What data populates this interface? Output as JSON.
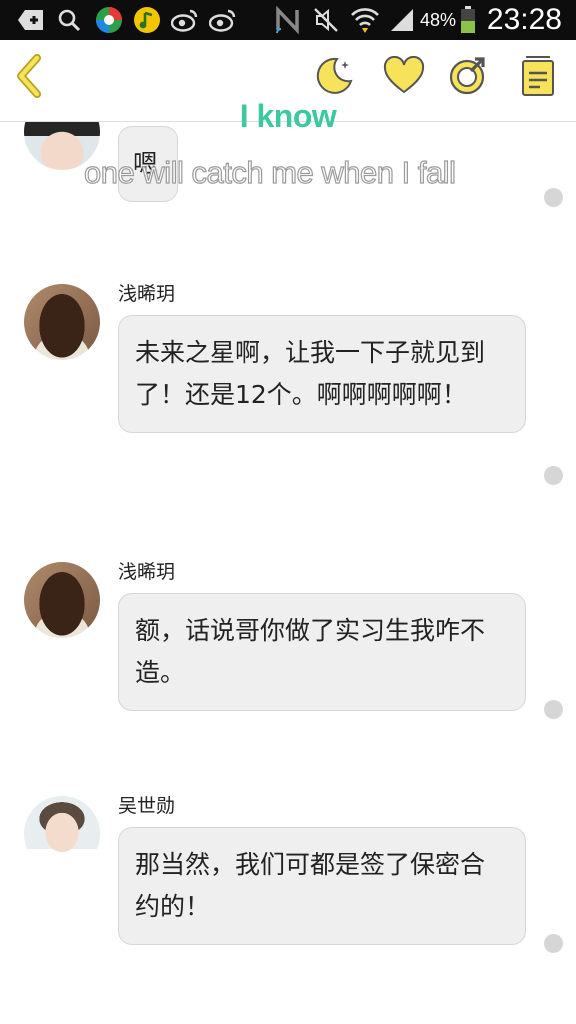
{
  "status_bar": {
    "battery_percent": "48%",
    "time": "23:28",
    "icons": [
      "add-icon",
      "search-icon",
      "app-icon",
      "music-icon",
      "weibo-icon",
      "weibo-icon",
      "nfc-icon",
      "mute-icon",
      "wifi-icon",
      "signal-icon",
      "battery-icon"
    ]
  },
  "header": {
    "icons": [
      "back-icon",
      "night-mode-icon",
      "favorite-icon",
      "share-icon",
      "notes-icon"
    ],
    "accent_color": "#f6e35a"
  },
  "lyrics": {
    "line1": "I know",
    "line2": "one will catch me when I fall"
  },
  "messages": [
    {
      "sender": "",
      "text": "嗯"
    },
    {
      "sender": "浅晞玥",
      "text": "未来之星啊，让我一下子就见到了！还是12个。啊啊啊啊啊！"
    },
    {
      "sender": "浅晞玥",
      "text": "额，话说哥你做了实习生我咋不造。"
    },
    {
      "sender": "吴世勋",
      "text": "那当然，我们可都是签了保密合约的！"
    }
  ]
}
